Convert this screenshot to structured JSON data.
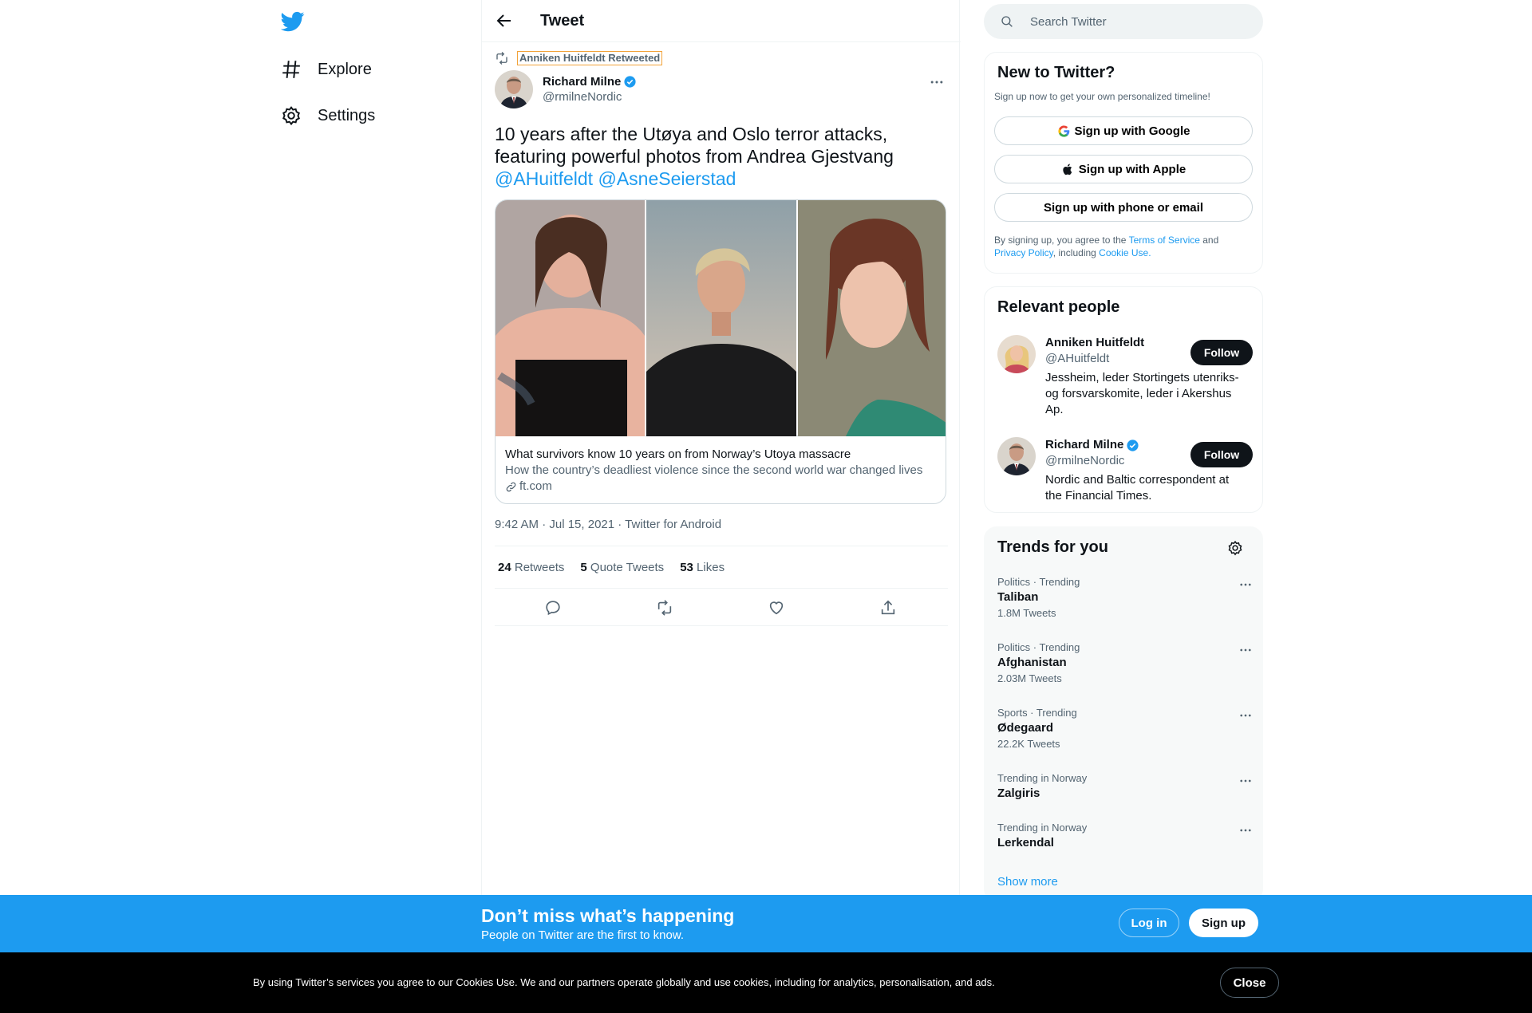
{
  "nav": {
    "items": [
      {
        "label": "Explore",
        "icon": "hashtag-icon"
      },
      {
        "label": "Settings",
        "icon": "gear-icon"
      }
    ]
  },
  "header": {
    "title": "Tweet"
  },
  "tweet": {
    "retweeted_by": "Anniken Huitfeldt Retweeted",
    "author_name": "Richard Milne",
    "author_handle": "@rmilneNordic",
    "text": "10 years after the Utøya and Oslo terror attacks, featuring powerful photos from Andrea Gjestvang",
    "mention_1": "@AHuitfeldt",
    "mention_2": "@AsneSeierstad",
    "card": {
      "title": "What survivors know 10 years on from Norway’s Utoya massacre",
      "description": "How the country’s deadliest violence since the second world war changed lives",
      "domain": "ft.com"
    },
    "timestamp": "9:42 AM · Jul 15, 2021 · Twitter for Android",
    "stats": {
      "retweets_count": "24",
      "retweets_label": "Retweets",
      "quotes_count": "5",
      "quotes_label": "Quote Tweets",
      "likes_count": "53",
      "likes_label": "Likes"
    }
  },
  "search": {
    "placeholder": "Search Twitter"
  },
  "signup": {
    "title": "New to Twitter?",
    "subtitle": "Sign up now to get your own personalized timeline!",
    "google": "Sign up with Google",
    "apple": "Sign up with Apple",
    "phone": "Sign up with phone or email",
    "terms_prefix": "By signing up, you agree to the ",
    "terms_link": "Terms of Service",
    "terms_and": " and ",
    "privacy_link": "Privacy Policy",
    "terms_including": ", including ",
    "cookie_link": "Cookie Use."
  },
  "people": {
    "title": "Relevant people",
    "items": [
      {
        "name": "Anniken Huitfeldt",
        "handle": "@AHuitfeldt",
        "bio": "Jessheim, leder Stortingets utenriks- og forsvarskomite, leder i Akershus Ap.",
        "follow": "Follow"
      },
      {
        "name": "Richard Milne",
        "handle": "@rmilneNordic",
        "bio": "Nordic and Baltic correspondent at the Financial Times.",
        "follow": "Follow"
      }
    ]
  },
  "trends": {
    "title": "Trends for you",
    "items": [
      {
        "meta": "Politics · Trending",
        "name": "Taliban",
        "count": "1.8M Tweets"
      },
      {
        "meta": "Politics · Trending",
        "name": "Afghanistan",
        "count": "2.03M Tweets"
      },
      {
        "meta": "Sports · Trending",
        "name": "Ødegaard",
        "count": "22.2K Tweets"
      },
      {
        "meta": "Trending in Norway",
        "name": "Zalgiris",
        "count": ""
      },
      {
        "meta": "Trending in Norway",
        "name": "Lerkendal",
        "count": ""
      }
    ],
    "show_more": "Show more"
  },
  "banner": {
    "title": "Don’t miss what’s happening",
    "subtitle": "People on Twitter are the first to know.",
    "login": "Log in",
    "signup": "Sign up"
  },
  "cookie": {
    "text": "By using Twitter’s services you agree to our Cookies Use. We and our partners operate globally and use cookies, including for analytics, personalisation, and ads.",
    "close": "Close"
  },
  "colors": {
    "accent": "#1d9bf0",
    "text": "#0f1419",
    "muted": "#536471"
  }
}
